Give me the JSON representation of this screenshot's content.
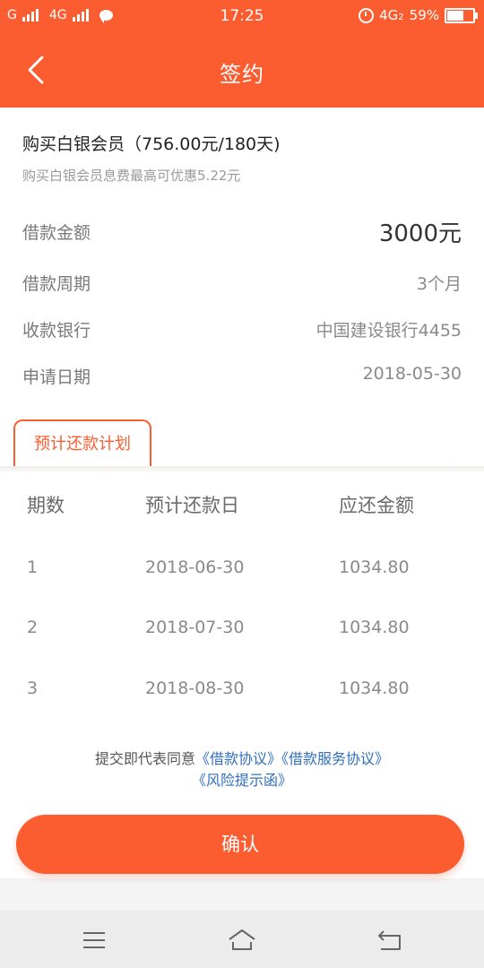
{
  "status_bar": {
    "carrier1": "G",
    "carrier2": "4G",
    "time": "17:25",
    "network": "4G",
    "network_sub": "2",
    "battery": "59%",
    "battery_level": 0.59,
    "icons": [
      "signal-icon",
      "signal-icon",
      "chat-icon",
      "alarm-icon",
      "battery-icon"
    ]
  },
  "header": {
    "title": "签约",
    "back_icon": "chevron-left-icon"
  },
  "membership": {
    "title": "购买白银会员（756.00元/180天)",
    "subtitle": "购买白银会员息费最高可优惠5.22元"
  },
  "details": [
    {
      "label": "借款金额",
      "value": "3000元"
    },
    {
      "label": "借款周期",
      "value": "3个月"
    },
    {
      "label": "收款银行",
      "value": "中国建设银行4455"
    },
    {
      "label": "申请日期",
      "value": "2018-05-30"
    }
  ],
  "tab": {
    "label": "预计还款计划"
  },
  "plan": {
    "headers": [
      "期数",
      "预计还款日",
      "应还金额"
    ],
    "rows": [
      [
        "1",
        "2018-06-30",
        "1034.80"
      ],
      [
        "2",
        "2018-07-30",
        "1034.80"
      ],
      [
        "3",
        "2018-08-30",
        "1034.80"
      ]
    ]
  },
  "agreement": {
    "prefix": "提交即代表同意",
    "link1": "《借款协议》",
    "link2": "《借款服务协议》",
    "link3": "《风险提示函》"
  },
  "actions": {
    "confirm": "确认"
  },
  "colors": {
    "brand": "#fb5d30",
    "link": "#2f6fbd"
  },
  "nav": {
    "icons": [
      "menu-icon",
      "home-icon",
      "back-icon"
    ]
  }
}
